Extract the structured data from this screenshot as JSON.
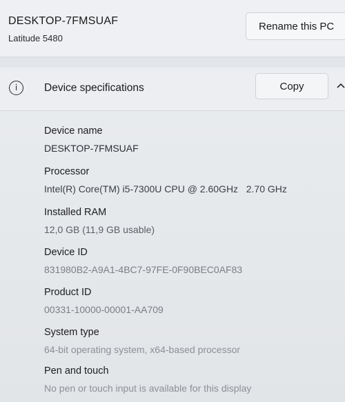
{
  "pc": {
    "name": "DESKTOP-7FMSUAF",
    "model": "Latitude 5480",
    "rename_label": "Rename this PC"
  },
  "specs_section": {
    "icon": "info-icon",
    "icon_glyph": "i",
    "title": "Device specifications",
    "copy_label": "Copy",
    "expanded": true
  },
  "specs": [
    {
      "label": "Device name",
      "value": "DESKTOP-7FMSUAF"
    },
    {
      "label": "Processor",
      "value": "Intel(R) Core(TM) i5-7300U CPU @ 2.60GHz   2.70 GHz"
    },
    {
      "label": "Installed RAM",
      "value": "12,0 GB (11,9 GB usable)"
    },
    {
      "label": "Device ID",
      "value": "831980B2-A9A1-4BC7-97FE-0F90BEC0AF83"
    },
    {
      "label": "Product ID",
      "value": "00331-10000-00001-AA709"
    },
    {
      "label": "System type",
      "value": "64-bit operating system, x64-based processor"
    },
    {
      "label": "Pen and touch",
      "value": "No pen or touch input is available for this display"
    }
  ]
}
